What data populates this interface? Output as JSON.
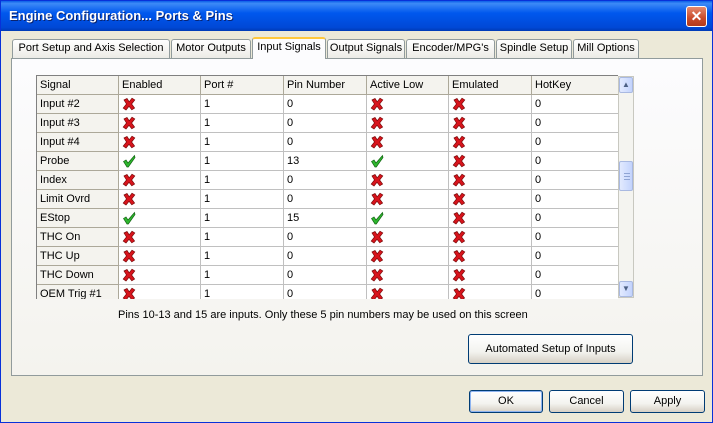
{
  "window": {
    "title": "Engine Configuration... Ports & Pins",
    "close_label": "✕"
  },
  "tabs": [
    {
      "label": "Port Setup and Axis Selection",
      "active": false
    },
    {
      "label": "Motor Outputs",
      "active": false
    },
    {
      "label": "Input Signals",
      "active": true
    },
    {
      "label": "Output Signals",
      "active": false
    },
    {
      "label": "Encoder/MPG's",
      "active": false
    },
    {
      "label": "Spindle Setup",
      "active": false
    },
    {
      "label": "Mill Options",
      "active": false
    }
  ],
  "grid": {
    "columns": [
      "Signal",
      "Enabled",
      "Port #",
      "Pin Number",
      "Active Low",
      "Emulated",
      "HotKey"
    ],
    "rows": [
      {
        "signal": "Input #2",
        "enabled": "x",
        "port": "1",
        "pin": "0",
        "active_low": "x",
        "emulated": "x",
        "hotkey": "0"
      },
      {
        "signal": "Input #3",
        "enabled": "x",
        "port": "1",
        "pin": "0",
        "active_low": "x",
        "emulated": "x",
        "hotkey": "0"
      },
      {
        "signal": "Input #4",
        "enabled": "x",
        "port": "1",
        "pin": "0",
        "active_low": "x",
        "emulated": "x",
        "hotkey": "0"
      },
      {
        "signal": "Probe",
        "enabled": "check",
        "port": "1",
        "pin": "13",
        "active_low": "check",
        "emulated": "x",
        "hotkey": "0"
      },
      {
        "signal": "Index",
        "enabled": "x",
        "port": "1",
        "pin": "0",
        "active_low": "x",
        "emulated": "x",
        "hotkey": "0"
      },
      {
        "signal": "Limit Ovrd",
        "enabled": "x",
        "port": "1",
        "pin": "0",
        "active_low": "x",
        "emulated": "x",
        "hotkey": "0"
      },
      {
        "signal": "EStop",
        "enabled": "check",
        "port": "1",
        "pin": "15",
        "active_low": "check",
        "emulated": "x",
        "hotkey": "0"
      },
      {
        "signal": "THC On",
        "enabled": "x",
        "port": "1",
        "pin": "0",
        "active_low": "x",
        "emulated": "x",
        "hotkey": "0"
      },
      {
        "signal": "THC Up",
        "enabled": "x",
        "port": "1",
        "pin": "0",
        "active_low": "x",
        "emulated": "x",
        "hotkey": "0"
      },
      {
        "signal": "THC Down",
        "enabled": "x",
        "port": "1",
        "pin": "0",
        "active_low": "x",
        "emulated": "x",
        "hotkey": "0"
      },
      {
        "signal": "OEM Trig #1",
        "enabled": "x",
        "port": "1",
        "pin": "0",
        "active_low": "x",
        "emulated": "x",
        "hotkey": "0"
      }
    ]
  },
  "note": "Pins 10-13 and 15 are inputs. Only these 5 pin numbers may be used on this screen",
  "buttons": {
    "automated_setup": "Automated Setup of Inputs",
    "ok": "OK",
    "cancel": "Cancel",
    "apply": "Apply"
  },
  "colors": {
    "x_icon": "#D8141C",
    "check_icon": "#2EB82E",
    "title_bar": "#0058EE"
  },
  "icons": {
    "x_icon": "red-x-icon",
    "check_icon": "green-check-icon"
  }
}
